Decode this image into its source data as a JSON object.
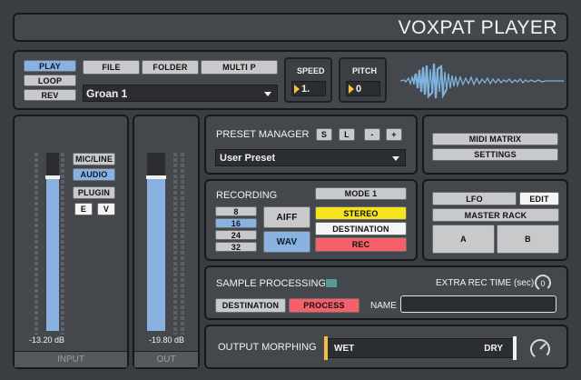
{
  "app": {
    "title": "VOXPAT PLAYER"
  },
  "transport": {
    "play": "PLAY",
    "loop": "LOOP",
    "rev": "REV",
    "file": "FILE",
    "folder": "FOLDER",
    "multi": "MULTI P",
    "sample_name": "Groan 1",
    "speed_label": "SPEED",
    "speed_value": "1.",
    "pitch_label": "PITCH",
    "pitch_value": "0"
  },
  "input": {
    "sources": [
      "MIC/LINE",
      "AUDIO",
      "PLUGIN"
    ],
    "selected": "AUDIO",
    "e": "E",
    "v": "V",
    "level_db": "-13.20 dB",
    "footer": "INPUT",
    "fader_level": 0.86
  },
  "output": {
    "level_db": "-19.80 dB",
    "footer": "OUT",
    "fader_level": 0.86
  },
  "preset_manager": {
    "label": "PRESET MANAGER",
    "buttons": [
      "S",
      "L",
      "-",
      "+"
    ],
    "preset": "User Preset"
  },
  "midi": {
    "matrix": "MIDI MATRIX",
    "settings": "SETTINGS"
  },
  "recording": {
    "label": "RECORDING",
    "mode": "MODE 1",
    "bit_depths": [
      "8",
      "16",
      "24",
      "32"
    ],
    "selected_bit": "16",
    "aiff": "AIFF",
    "wav": "WAV",
    "stereo": "STEREO",
    "destination": "DESTINATION",
    "rec": "REC"
  },
  "modulation": {
    "lfo": "LFO",
    "edit": "EDIT",
    "master_rack": "MASTER RACK",
    "a": "A",
    "b": "B"
  },
  "sample_processing": {
    "label": "SAMPLE PROCESSING",
    "extra_rec": "EXTRA REC TIME (sec)",
    "extra_rec_value": "0",
    "destination": "DESTINATION",
    "process": "PROCESS",
    "name_label": "NAME",
    "name_value": ""
  },
  "morphing": {
    "label": "OUTPUT MORPHING",
    "wet": "WET",
    "dry": "DRY"
  },
  "colors": {
    "accent_blue": "#8ab2e0",
    "waveform": "#7fb2de",
    "rec_red": "#f5606a",
    "stereo_yellow": "#f5e41b",
    "teal": "#5a9a96"
  }
}
